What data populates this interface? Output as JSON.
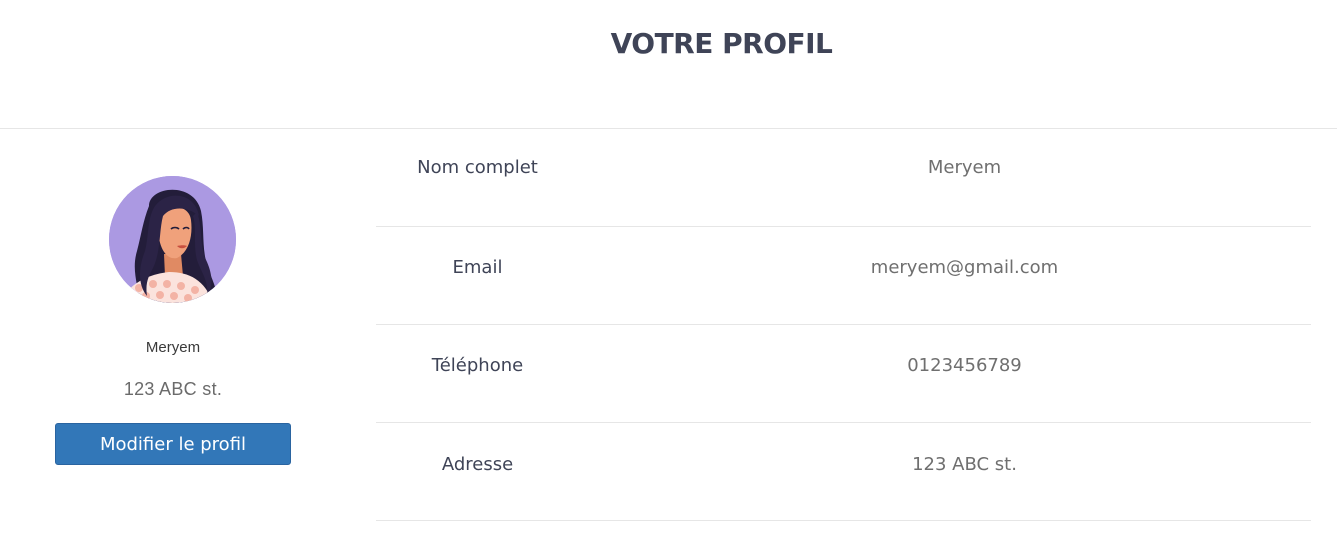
{
  "header": {
    "title": "VOTRE PROFIL"
  },
  "profile": {
    "avatar_icon": "woman-avatar-icon",
    "name": "Meryem",
    "address": "123 ABC st.",
    "edit_label": "Modifier le profil",
    "colors": {
      "avatar_bg": "#ab99e2",
      "button": "#3277b8"
    }
  },
  "info": {
    "rows": [
      {
        "label": "Nom complet",
        "value": "Meryem"
      },
      {
        "label": "Email",
        "value": "meryem@gmail.com"
      },
      {
        "label": "Téléphone",
        "value": "0123456789"
      },
      {
        "label": "Adresse",
        "value": "123 ABC st."
      }
    ]
  }
}
